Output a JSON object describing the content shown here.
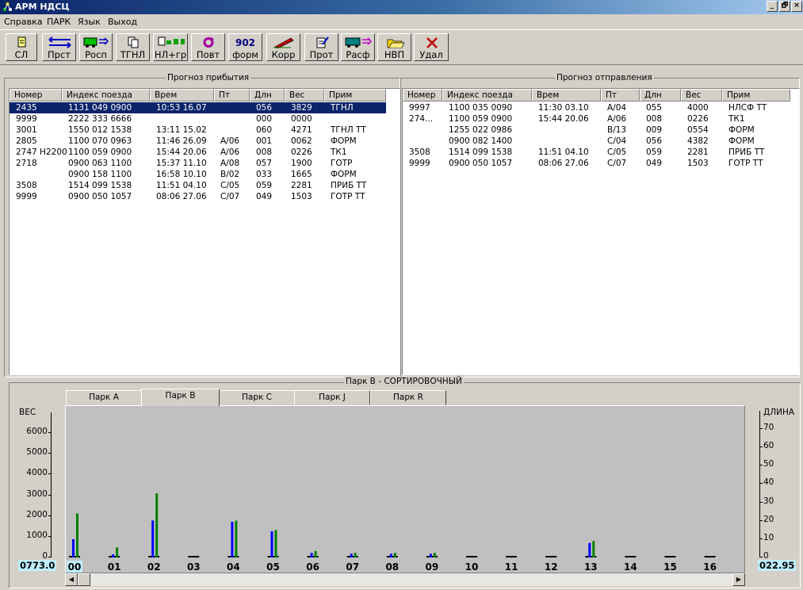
{
  "window": {
    "title": "АРМ НДСЦ",
    "controls": [
      "_",
      "🗗",
      "×"
    ]
  },
  "menu": [
    "Справка",
    "ПАРК",
    "Язык",
    "Выход"
  ],
  "toolbar": [
    {
      "label": "СЛ",
      "icon": "document-icon"
    },
    {
      "label": "Прст",
      "icon": "swap-arrows-icon"
    },
    {
      "label": "Росп",
      "icon": "wagon-arrow-icon"
    },
    {
      "label": "ТГНЛ",
      "icon": "documents-icon"
    },
    {
      "label": "НЛ+гр",
      "icon": "docs-wagons-icon"
    },
    {
      "label": "Повт",
      "icon": "repeat-icon"
    },
    {
      "label": "форм",
      "big": "902"
    },
    {
      "label": "Корр",
      "icon": "pencil-icon"
    },
    {
      "label": "Прот",
      "icon": "protocol-icon"
    },
    {
      "label": "Расф",
      "icon": "unform-icon"
    },
    {
      "label": "НВП",
      "icon": "open-folder-icon"
    },
    {
      "label": "Удал",
      "icon": "delete-x-icon"
    }
  ],
  "arrival": {
    "title": "Прогноз прибытия",
    "columns": [
      "Номер",
      "Индекс поезда",
      "Врем",
      "Пт",
      "Длн",
      "Вес",
      "Прим"
    ],
    "rows": [
      [
        "2435",
        "1131 049 0900",
        "10:53  16.07",
        "",
        "056",
        "3829",
        "ТГНЛ"
      ],
      [
        "9999",
        "2222 333 6666",
        "",
        "",
        "000",
        "0000",
        ""
      ],
      [
        "3001",
        "1550 012 1538",
        "13:11  15.02",
        "",
        "060",
        "4271",
        "ТГНЛ ТТ"
      ],
      [
        "2805",
        "1100 070 0963",
        "11:46  26.09",
        "А/06",
        "001",
        "0062",
        "ФОРМ"
      ],
      [
        "2747 Н2200",
        "1100 059 0900",
        "15:44  20.06",
        "А/06",
        "008",
        "0226",
        "ТК1"
      ],
      [
        "2718",
        "0900 063 1100",
        "15:37  11.10",
        "А/08",
        "057",
        "1900",
        "ГОТР"
      ],
      [
        "",
        "0900 158 1100",
        "16:58  10.10",
        "В/02",
        "033",
        "1665",
        "ФОРМ"
      ],
      [
        "3508",
        "1514 099 1538",
        "11:51  04.10",
        "С/05",
        "059",
        "2281",
        "ПРИБ ТТ"
      ],
      [
        "9999",
        "0900 050 1057",
        "08:06  27.06",
        "С/07",
        "049",
        "1503",
        "ГОТР ТТ"
      ]
    ]
  },
  "departure": {
    "title": "Прогноз отправления",
    "columns": [
      "Номер",
      "Индекс поезда",
      "Врем",
      "Пт",
      "Длн",
      "Вес",
      "Прим"
    ],
    "rows": [
      [
        "9997",
        "1100 035 0090",
        "11:30  03.10",
        "А/04",
        "055",
        "4000",
        "НЛСФ ТТ"
      ],
      [
        "274...",
        "1100 059 0900",
        "15:44  20.06",
        "А/06",
        "008",
        "0226",
        "ТК1"
      ],
      [
        "",
        "1255 022 0986",
        "",
        "В/13",
        "009",
        "0554",
        "ФОРМ"
      ],
      [
        "",
        "0900 082 1400",
        "",
        "С/04",
        "056",
        "4382",
        "ФОРМ"
      ],
      [
        "3508",
        "1514 099 1538",
        "11:51  04.10",
        "С/05",
        "059",
        "2281",
        "ПРИБ ТТ"
      ],
      [
        "9999",
        "0900 050 1057",
        "08:06  27.06",
        "С/07",
        "049",
        "1503",
        "ГОТР ТТ"
      ]
    ]
  },
  "park": {
    "title": "Парк В - СОРТИРОВОЧНЫЙ",
    "tabs": [
      "Парк А",
      "Парк В",
      "Парк С",
      "Парк J",
      "Парк R"
    ],
    "active_tab": 1,
    "left_value": "0773.0",
    "right_value": "022.95"
  },
  "chart_data": {
    "type": "bar",
    "left_axis": {
      "label": "ВЕС",
      "ticks": [
        "0",
        "1000",
        "2000",
        "3000",
        "4000",
        "5000",
        "6000"
      ],
      "range": [
        0,
        6000
      ]
    },
    "right_axis": {
      "label": "ДЛИНА",
      "ticks": [
        "0",
        "10",
        "20",
        "30",
        "40",
        "50",
        "60",
        "70"
      ],
      "range": [
        0,
        70
      ]
    },
    "categories": [
      "00",
      "01",
      "02",
      "03",
      "04",
      "05",
      "06",
      "07",
      "08",
      "09",
      "10",
      "11",
      "12",
      "13",
      "14",
      "15",
      "16"
    ],
    "series": [
      {
        "color": "#0000ff",
        "axis": "left",
        "values": [
          880,
          150,
          1780,
          0,
          1720,
          1260,
          220,
          180,
          180,
          180,
          0,
          0,
          0,
          700,
          0,
          0,
          0
        ]
      },
      {
        "color": "#008000",
        "axis": "right",
        "values": [
          24,
          5.5,
          35,
          0,
          20,
          15,
          3.5,
          2.5,
          2.5,
          2.5,
          0,
          0,
          0,
          9,
          0,
          0,
          0
        ]
      }
    ],
    "colors": {
      "left": "#0000ff",
      "right": "#008000"
    }
  }
}
